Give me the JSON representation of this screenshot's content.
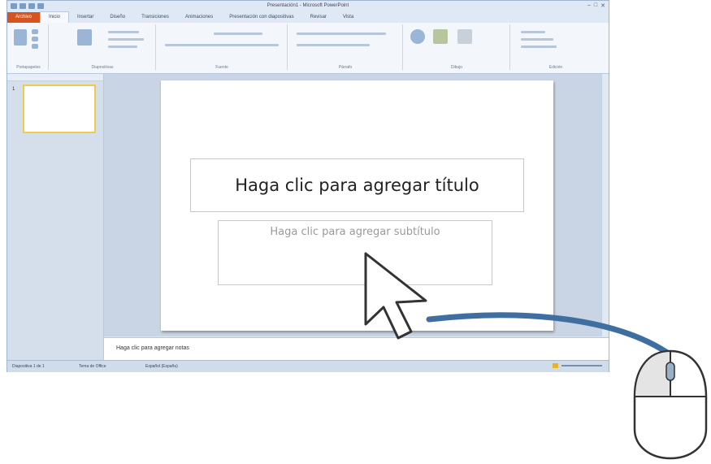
{
  "window": {
    "title": "Presentación1 - Microsoft PowerPoint"
  },
  "tabs": [
    "Archivo",
    "Inicio",
    "Insertar",
    "Diseño",
    "Transiciones",
    "Animaciones",
    "Presentación con diapositivas",
    "Revisar",
    "Vista"
  ],
  "ribbon": {
    "groups": [
      "Portapapeles",
      "Diapositivas",
      "Fuente",
      "Párrafo",
      "Dibujo",
      "Edición"
    ]
  },
  "thumbnails": {
    "number": "1"
  },
  "slide": {
    "title_placeholder": "Haga clic para agregar título",
    "subtitle_placeholder": "Haga clic para agregar subtítulo"
  },
  "notes": {
    "text": "Haga clic para agregar notas"
  },
  "status": {
    "slide": "Diapositiva 1 de 1",
    "theme": "Tema de Office",
    "language": "Español (España)"
  },
  "colors": {
    "file_tab": "#d9531e",
    "cable": "#3f6fa0",
    "thumb_border": "#f2c94c"
  }
}
